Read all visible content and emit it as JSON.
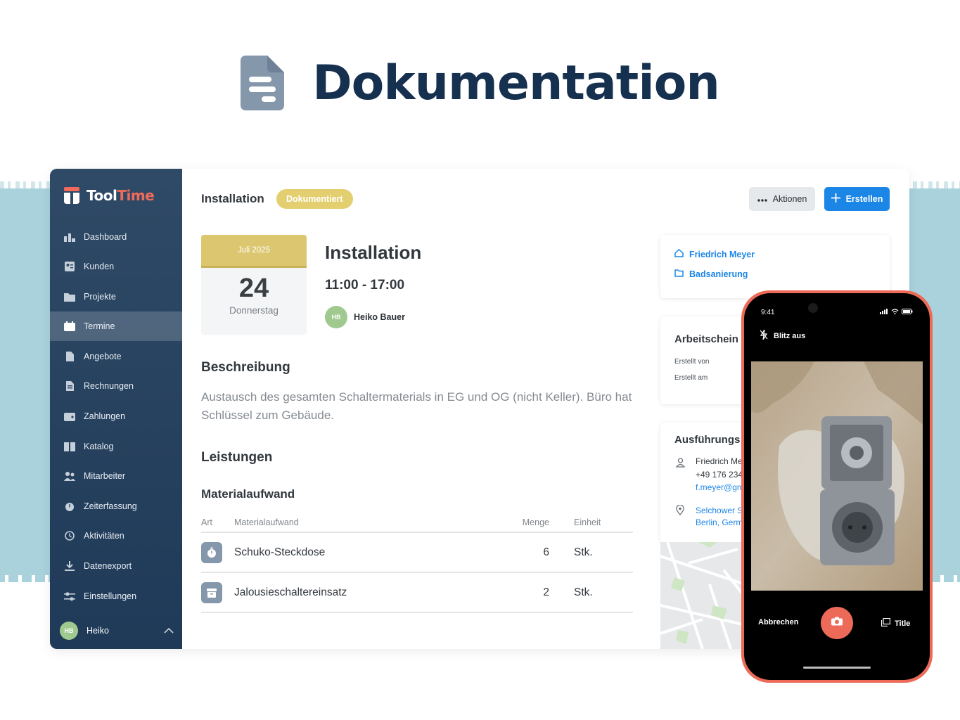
{
  "hero": {
    "title": "Dokumentation",
    "icon": "document-icon",
    "icon_color": "#8497ab",
    "title_color": "#16304f"
  },
  "app": {
    "logo": {
      "part1": "Tool",
      "part2": "Time",
      "accent": "#f06a5a"
    },
    "sidebar": {
      "items": [
        {
          "label": "Dashboard",
          "icon": "chart-icon"
        },
        {
          "label": "Kunden",
          "icon": "contacts-icon"
        },
        {
          "label": "Projekte",
          "icon": "folder-icon"
        },
        {
          "label": "Termine",
          "icon": "calendar-icon",
          "active": true
        },
        {
          "label": "Angebote",
          "icon": "file-icon"
        },
        {
          "label": "Rechnungen",
          "icon": "invoice-icon"
        },
        {
          "label": "Zahlungen",
          "icon": "wallet-icon"
        },
        {
          "label": "Katalog",
          "icon": "book-icon"
        },
        {
          "label": "Mitarbeiter",
          "icon": "users-icon"
        },
        {
          "label": "Zeiterfassung",
          "icon": "stopwatch-icon"
        },
        {
          "label": "Aktivitäten",
          "icon": "history-icon"
        },
        {
          "label": "Datenexport",
          "icon": "download-icon"
        },
        {
          "label": "Einstellungen",
          "icon": "sliders-icon"
        }
      ],
      "user": {
        "initials": "HB",
        "name": "Heiko"
      }
    },
    "topbar": {
      "title": "Installation",
      "badge": "Dokumentiert",
      "actions_label": "Aktionen",
      "create_label": "Erstellen"
    },
    "event": {
      "month": "Juli 2025",
      "day": "24",
      "weekday": "Donnerstag",
      "title": "Installation",
      "time": "11:00 - 17:00",
      "person": {
        "initials": "HB",
        "name": "Heiko Bauer"
      }
    },
    "description": {
      "heading": "Beschreibung",
      "text": "Austausch des gesamten Schaltermaterials in EG und OG (nicht Keller). Büro hat Schlüssel zum Gebäude."
    },
    "services": {
      "heading": "Leistungen",
      "subheading": "Materialaufwand",
      "columns": [
        "Art",
        "Materialaufwand",
        "Menge",
        "Einheit"
      ],
      "rows": [
        {
          "icon": "stopwatch-icon",
          "name": "Schuko-Steckdose",
          "qty": "6",
          "unit": "Stk."
        },
        {
          "icon": "archive-icon",
          "name": "Jalousieschaltereinsatz",
          "qty": "2",
          "unit": "Stk."
        }
      ]
    },
    "right": {
      "customer": "Friedrich Meyer",
      "project": "Badsanierung",
      "worksheet": {
        "title": "Arbeitschein",
        "created_by": "Erstellt von",
        "created_at": "Erstellt am"
      },
      "execution": {
        "title": "Ausführungs",
        "name": "Friedrich Me",
        "phone": "+49 176 234",
        "email": "f.meyer@gm",
        "street": "Selchower S",
        "city": "Berlin, Germ"
      }
    }
  },
  "phone": {
    "time": "9:41",
    "flash": "Blitz aus",
    "cancel": "Abbrechen",
    "title_btn": "Title"
  }
}
